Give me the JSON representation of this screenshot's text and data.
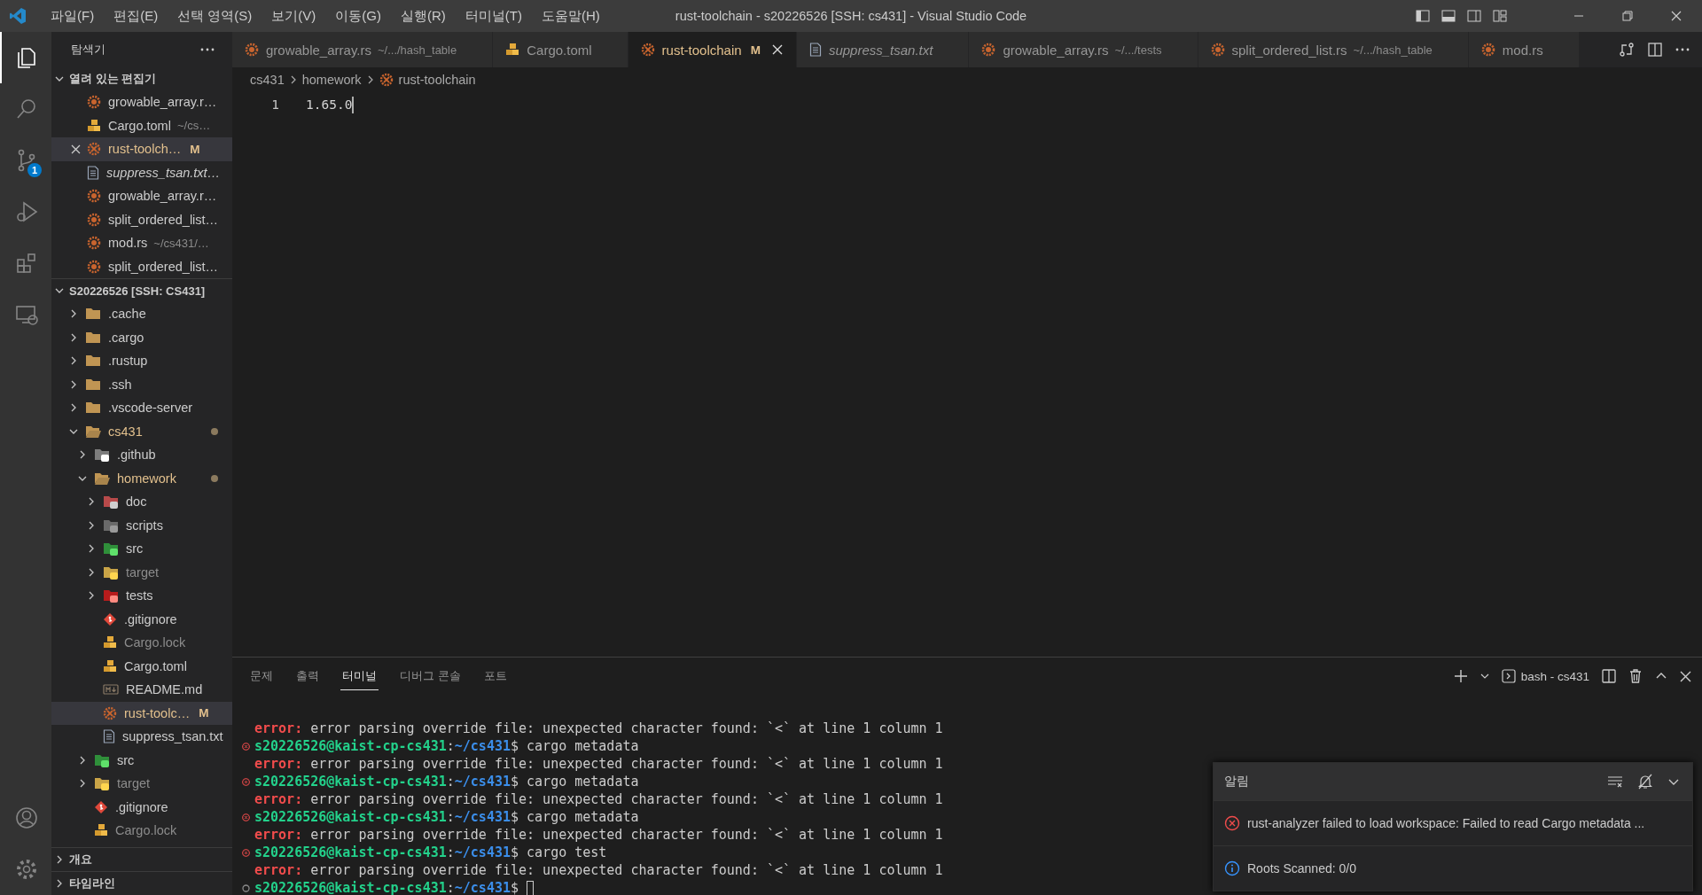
{
  "title_bar": {
    "menus": [
      "파일(F)",
      "편집(E)",
      "선택 영역(S)",
      "보기(V)",
      "이동(G)",
      "실행(R)",
      "터미널(T)",
      "도움말(H)"
    ],
    "title": "rust-toolchain - s20226526 [SSH: cs431] - Visual Studio Code"
  },
  "activity_bar": {
    "items": [
      {
        "kind": "explorer",
        "selected": true
      },
      {
        "kind": "search",
        "selected": false
      },
      {
        "kind": "source-control",
        "selected": false,
        "badge": "1"
      },
      {
        "kind": "run-debug",
        "selected": false
      },
      {
        "kind": "extensions",
        "selected": false
      },
      {
        "kind": "remote",
        "selected": false
      }
    ],
    "bottom": [
      {
        "kind": "accounts"
      },
      {
        "kind": "settings"
      }
    ]
  },
  "sidebar": {
    "title": "탐색기",
    "open_editors": {
      "title": "열려 있는 편집기",
      "expanded": true,
      "items": [
        {
          "name": "growable_array.r…",
          "kind": "rust",
          "selected": false,
          "modified": false,
          "preview": false
        },
        {
          "name": "Cargo.toml",
          "description": "~/cs…",
          "kind": "toml",
          "selected": false,
          "modified": false,
          "preview": false
        },
        {
          "name": "rust-toolch…",
          "kind": "toolchain",
          "selected": true,
          "modified": true,
          "badge": "M",
          "preview": false
        },
        {
          "name": "suppress_tsan.txt…",
          "kind": "text",
          "selected": false,
          "modified": false,
          "preview": true
        },
        {
          "name": "growable_array.r…",
          "kind": "rust",
          "selected": false,
          "modified": false,
          "preview": false
        },
        {
          "name": "split_ordered_list…",
          "kind": "rust",
          "selected": false,
          "modified": false,
          "preview": false
        },
        {
          "name": "mod.rs",
          "description": "~/cs431/…",
          "kind": "rust",
          "selected": false,
          "modified": false,
          "preview": false
        },
        {
          "name": "split_ordered_list…",
          "kind": "rust",
          "selected": false,
          "modified": false,
          "preview": false
        }
      ]
    },
    "workspace": {
      "title": "S20226526 [SSH: CS431]",
      "expanded": true,
      "tree": [
        {
          "name": ".cache",
          "kind": "folder",
          "expanded": false,
          "selected": false
        },
        {
          "name": ".cargo",
          "kind": "folder",
          "expanded": false,
          "selected": false
        },
        {
          "name": ".rustup",
          "kind": "folder",
          "expanded": false,
          "selected": false
        },
        {
          "name": ".ssh",
          "kind": "folder",
          "expanded": false,
          "selected": false
        },
        {
          "name": ".vscode-server",
          "kind": "folder",
          "expanded": false,
          "selected": false
        },
        {
          "name": "cs431",
          "kind": "folder",
          "expanded": true,
          "selected": false,
          "modified": true,
          "children": [
            {
              "name": ".github",
              "kind": "folder-github",
              "expanded": false,
              "selected": false
            },
            {
              "name": "homework",
              "kind": "folder",
              "expanded": true,
              "selected": false,
              "modified": true,
              "children": [
                {
                  "name": "doc",
                  "kind": "folder-doc",
                  "expanded": false,
                  "selected": false
                },
                {
                  "name": "scripts",
                  "kind": "folder-scripts",
                  "expanded": false,
                  "selected": false
                },
                {
                  "name": "src",
                  "kind": "folder-src",
                  "expanded": false,
                  "selected": false
                },
                {
                  "name": "target",
                  "kind": "folder-target",
                  "expanded": false,
                  "selected": false,
                  "ignored": true
                },
                {
                  "name": "tests",
                  "kind": "folder-tests",
                  "expanded": false,
                  "selected": false
                },
                {
                  "name": ".gitignore",
                  "kind": "git",
                  "selected": false
                },
                {
                  "name": "Cargo.lock",
                  "kind": "toml",
                  "selected": false,
                  "ignored": true
                },
                {
                  "name": "Cargo.toml",
                  "kind": "toml",
                  "selected": false
                },
                {
                  "name": "README.md",
                  "kind": "markdown",
                  "selected": false
                },
                {
                  "name": "rust-toolc…",
                  "kind": "toolchain",
                  "selected": true,
                  "modified": true,
                  "badge": "M"
                },
                {
                  "name": "suppress_tsan.txt",
                  "kind": "text",
                  "selected": false
                }
              ]
            },
            {
              "name": "src",
              "kind": "folder-src",
              "expanded": false,
              "selected": false
            },
            {
              "name": "target",
              "kind": "folder-target",
              "expanded": false,
              "selected": false,
              "ignored": true
            },
            {
              "name": ".gitignore",
              "kind": "git",
              "selected": false
            },
            {
              "name": "Cargo.lock",
              "kind": "toml",
              "selected": false,
              "ignored": true
            }
          ]
        }
      ]
    },
    "sections": [
      {
        "title": "개요",
        "expanded": false
      },
      {
        "title": "타임라인",
        "expanded": false
      }
    ]
  },
  "editor": {
    "tabs": [
      {
        "name": "growable_array.rs",
        "description": "~/.../hash_table",
        "kind": "rust",
        "selected": false,
        "modified": false,
        "preview": false
      },
      {
        "name": "Cargo.toml",
        "kind": "toml",
        "selected": false,
        "modified": false,
        "preview": false
      },
      {
        "name": "rust-toolchain",
        "kind": "toolchain",
        "selected": true,
        "modified": true,
        "badge": "M",
        "preview": false
      },
      {
        "name": "suppress_tsan.txt",
        "kind": "text",
        "selected": false,
        "modified": false,
        "preview": true
      },
      {
        "name": "growable_array.rs",
        "description": "~/.../tests",
        "kind": "rust",
        "selected": false,
        "modified": false,
        "preview": false
      },
      {
        "name": "split_ordered_list.rs",
        "description": "~/.../hash_table",
        "kind": "rust",
        "selected": false,
        "modified": false,
        "preview": false
      },
      {
        "name": "mod.rs",
        "kind": "rust",
        "selected": false,
        "modified": false,
        "preview": false
      }
    ],
    "breadcrumbs": [
      {
        "text": "cs431"
      },
      {
        "text": "homework"
      },
      {
        "text": "rust-toolchain",
        "kind": "toolchain"
      }
    ],
    "lines": [
      {
        "number": "1",
        "text": "1.65.0"
      }
    ]
  },
  "panel": {
    "tabs": [
      {
        "label": "문제",
        "selected": false
      },
      {
        "label": "출력",
        "selected": false
      },
      {
        "label": "터미널",
        "selected": true
      },
      {
        "label": "디버그 콘솔",
        "selected": false
      },
      {
        "label": "포트",
        "selected": false
      }
    ],
    "terminal_name": "bash - cs431",
    "lines": [
      {
        "kind": "error",
        "label": "error:",
        "text": "error parsing override file: unexpected character found: `<` at line 1 column 1"
      },
      {
        "kind": "prompt",
        "failed": true,
        "user": "s20226526@kaist-cp-cs431",
        "sep": ":",
        "path": "~/cs431",
        "command": "$ cargo metadata"
      },
      {
        "kind": "error",
        "label": "error:",
        "text": "error parsing override file: unexpected character found: `<` at line 1 column 1"
      },
      {
        "kind": "prompt",
        "failed": true,
        "user": "s20226526@kaist-cp-cs431",
        "sep": ":",
        "path": "~/cs431",
        "command": "$ cargo metadata"
      },
      {
        "kind": "error",
        "label": "error:",
        "text": "error parsing override file: unexpected character found: `<` at line 1 column 1"
      },
      {
        "kind": "prompt",
        "failed": true,
        "user": "s20226526@kaist-cp-cs431",
        "sep": ":",
        "path": "~/cs431",
        "command": "$ cargo metadata"
      },
      {
        "kind": "error",
        "label": "error:",
        "text": "error parsing override file: unexpected character found: `<` at line 1 column 1"
      },
      {
        "kind": "prompt",
        "failed": true,
        "user": "s20226526@kaist-cp-cs431",
        "sep": ":",
        "path": "~/cs431",
        "command": "$ cargo test"
      },
      {
        "kind": "error",
        "label": "error:",
        "text": "error parsing override file: unexpected character found: `<` at line 1 column 1"
      },
      {
        "kind": "prompt",
        "failed": false,
        "user": "s20226526@kaist-cp-cs431",
        "sep": ":",
        "path": "~/cs431",
        "command": "$",
        "cursor": true
      }
    ]
  },
  "notifications": {
    "title": "알림",
    "items": [
      {
        "kind": "error",
        "message": "rust-analyzer failed to load workspace: Failed to read Cargo metadata ..."
      },
      {
        "kind": "info",
        "message": "Roots Scanned: 0/0"
      }
    ]
  }
}
